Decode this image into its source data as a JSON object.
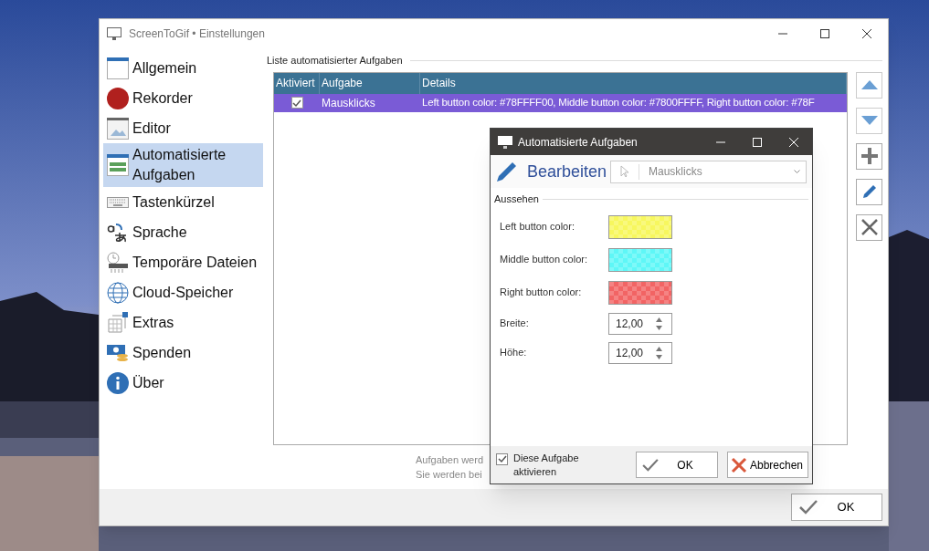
{
  "window": {
    "title": "ScreenToGif • Einstellungen"
  },
  "sidebar": {
    "items": [
      {
        "label": "Allgemein",
        "selected": false
      },
      {
        "label": "Rekorder",
        "selected": false
      },
      {
        "label": "Editor",
        "selected": false
      },
      {
        "label": "Automatisierte Aufgaben",
        "selected": true
      },
      {
        "label": "Tastenkürzel",
        "selected": false
      },
      {
        "label": "Sprache",
        "selected": false
      },
      {
        "label": "Temporäre Dateien",
        "selected": false
      },
      {
        "label": "Cloud-Speicher",
        "selected": false
      },
      {
        "label": "Extras",
        "selected": false
      },
      {
        "label": "Spenden",
        "selected": false
      },
      {
        "label": "Über",
        "selected": false
      }
    ]
  },
  "task_list": {
    "title": "Liste automatisierter Aufgaben",
    "columns": [
      "Aktiviert",
      "Aufgabe",
      "Details"
    ],
    "rows": [
      {
        "checked": true,
        "task": "Mausklicks",
        "details": "Left button color: #78FFFF00, Middle button color: #7800FFFF, Right button color: #78F",
        "selected": true
      }
    ]
  },
  "note_lines": [
    "Aufgaben werd",
    "Sie werden bei"
  ],
  "ok_button": "OK",
  "dialog": {
    "title": "Automatisierte Aufgaben",
    "heading": "Bearbeiten",
    "task_select": "Mausklicks",
    "group": "Aussehen",
    "colors": [
      {
        "label": "Left button color:",
        "color": "#f7f75e"
      },
      {
        "label": "Middle button color:",
        "color": "#5ef7f7"
      },
      {
        "label": "Right button color:",
        "color": "#f26464"
      }
    ],
    "numbers": [
      {
        "label": "Breite:",
        "value": "12,00"
      },
      {
        "label": "Höhe:",
        "value": "12,00"
      }
    ],
    "enable": {
      "label": "Diese Aufgabe aktivieren",
      "checked": true
    },
    "ok": "OK",
    "cancel": "Abbrechen"
  }
}
